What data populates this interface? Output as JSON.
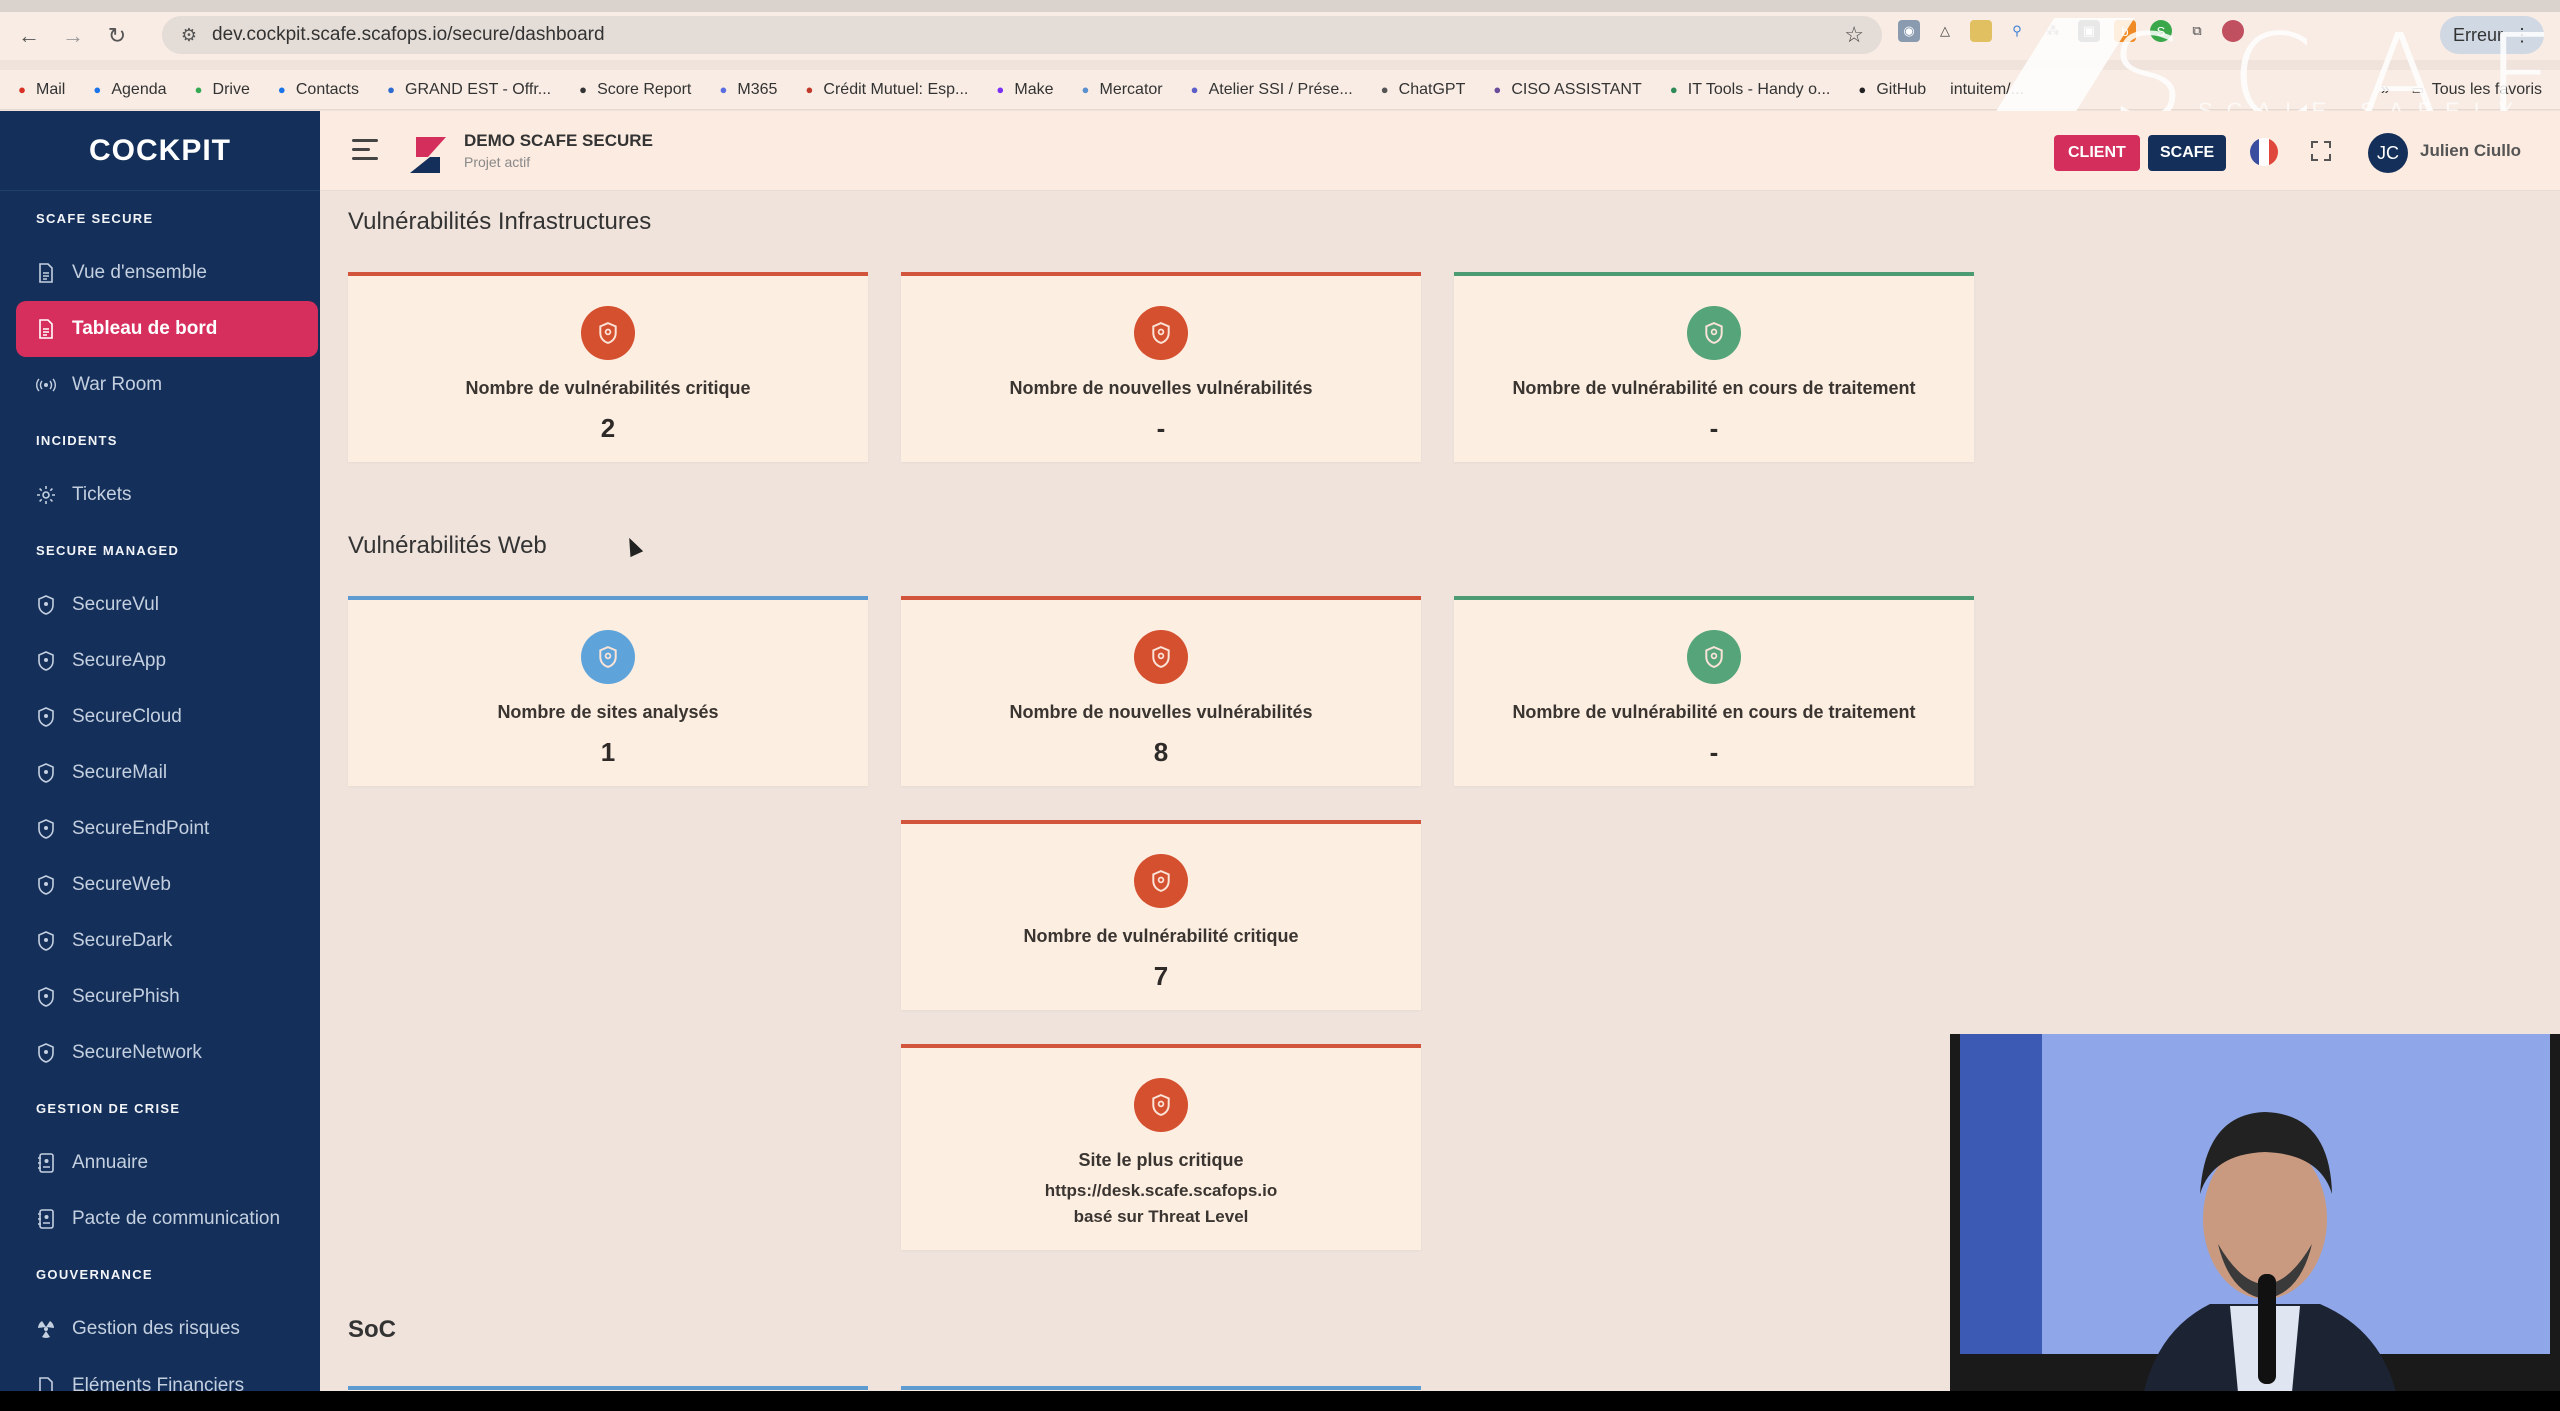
{
  "browser": {
    "url": "dev.cockpit.scafe.scafops.io/secure/dashboard",
    "profile_status": "Erreur",
    "bookmarks": [
      {
        "label": "Mail",
        "icon": "gmail-icon",
        "color": "#d93025"
      },
      {
        "label": "Agenda",
        "icon": "calendar-icon",
        "color": "#1a73e8"
      },
      {
        "label": "Drive",
        "icon": "drive-icon",
        "color": "#34a853"
      },
      {
        "label": "Contacts",
        "icon": "contacts-icon",
        "color": "#1a73e8"
      },
      {
        "label": "GRAND EST - Offr...",
        "icon": "check-icon",
        "color": "#2d6bd1"
      },
      {
        "label": "Score Report",
        "icon": "globe-icon",
        "color": "#333333"
      },
      {
        "label": "M365",
        "icon": "m365-icon",
        "color": "#5b6ee1"
      },
      {
        "label": "Crédit Mutuel: Esp...",
        "icon": "credit-mutuel-icon",
        "color": "#c0392b"
      },
      {
        "label": "Make",
        "icon": "make-icon",
        "color": "#7b2ff7"
      },
      {
        "label": "Mercator",
        "icon": "pin-icon",
        "color": "#5a8fd0"
      },
      {
        "label": "Atelier SSI / Prése...",
        "icon": "form-icon",
        "color": "#5b5fc7"
      },
      {
        "label": "ChatGPT",
        "icon": "chatgpt-icon",
        "color": "#555555"
      },
      {
        "label": "CISO ASSISTANT",
        "icon": "octopus-icon",
        "color": "#6a4c9c"
      },
      {
        "label": "IT Tools - Handy o...",
        "icon": "tools-icon",
        "color": "#2e8b57"
      },
      {
        "label": "GitHub",
        "icon": "github-icon",
        "color": "#222222"
      },
      {
        "label": "intuitem/...",
        "icon": "",
        "color": "#333333"
      }
    ],
    "more_bookmarks": "»",
    "all_bookmarks": "Tous les favoris"
  },
  "watermark": {
    "brand": "SCAFE",
    "tagline": "SCALE SAFELY"
  },
  "sidebar": {
    "logo": "COCKPIT",
    "sections": [
      {
        "title": "SCAFE SECURE",
        "items": [
          {
            "label": "Vue d'ensemble",
            "icon": "document-icon",
            "active": false
          },
          {
            "label": "Tableau de bord",
            "icon": "document-icon",
            "active": true
          },
          {
            "label": "War Room",
            "icon": "broadcast-icon",
            "active": false
          }
        ]
      },
      {
        "title": "INCIDENTS",
        "items": [
          {
            "label": "Tickets",
            "icon": "gear-icon",
            "active": false
          }
        ]
      },
      {
        "title": "SECURE MANAGED",
        "items": [
          {
            "label": "SecureVul",
            "icon": "shield-icon",
            "active": false
          },
          {
            "label": "SecureApp",
            "icon": "shield-icon",
            "active": false
          },
          {
            "label": "SecureCloud",
            "icon": "shield-icon",
            "active": false
          },
          {
            "label": "SecureMail",
            "icon": "shield-icon",
            "active": false
          },
          {
            "label": "SecureEndPoint",
            "icon": "shield-icon",
            "active": false
          },
          {
            "label": "SecureWeb",
            "icon": "shield-icon",
            "active": false
          },
          {
            "label": "SecureDark",
            "icon": "shield-icon",
            "active": false
          },
          {
            "label": "SecurePhish",
            "icon": "shield-icon",
            "active": false
          },
          {
            "label": "SecureNetwork",
            "icon": "shield-icon",
            "active": false
          }
        ]
      },
      {
        "title": "GESTION DE CRISE",
        "items": [
          {
            "label": "Annuaire",
            "icon": "address-book-icon",
            "active": false
          },
          {
            "label": "Pacte de communication",
            "icon": "address-book-icon",
            "active": false
          }
        ]
      },
      {
        "title": "GOUVERNANCE",
        "items": [
          {
            "label": "Gestion des risques",
            "icon": "hazard-icon",
            "active": false
          },
          {
            "label": "Eléments Financiers",
            "icon": "finance-doc-icon",
            "active": false
          }
        ]
      }
    ]
  },
  "header": {
    "project_name": "DEMO SCAFE SECURE",
    "project_status": "Projet actif",
    "client_button": "CLIENT",
    "scafe_button": "SCAFE",
    "language": "FR",
    "user_initials": "JC",
    "user_name": "Julien Ciullo"
  },
  "colors": {
    "critical": "#d4502f",
    "info": "#5ea4da",
    "success": "#55a47a",
    "sidebar_bg": "#14305a",
    "active_item": "#d62f5e"
  },
  "sections": {
    "infra": {
      "title": "Vulnérabilités Infrastructures",
      "cards": [
        {
          "label": "Nombre de vulnérabilités critique",
          "value": "2",
          "tone": "critical"
        },
        {
          "label": "Nombre de nouvelles vulnérabilités",
          "value": "-",
          "tone": "critical"
        },
        {
          "label": "Nombre de vulnérabilité en cours de traitement",
          "value": "-",
          "tone": "success"
        }
      ]
    },
    "web": {
      "title": "Vulnérabilités Web",
      "cards": [
        {
          "label": "Nombre de sites analysés",
          "value": "1",
          "tone": "info"
        },
        {
          "label": "Nombre de nouvelles vulnérabilités",
          "value": "8",
          "tone": "critical"
        },
        {
          "label": "Nombre de vulnérabilité en cours de traitement",
          "value": "-",
          "tone": "success"
        },
        {
          "label": "Nombre de vulnérabilité critique",
          "value": "7",
          "tone": "critical"
        },
        {
          "label": "Site le plus critique",
          "url": "https://desk.scafe.scafops.io",
          "basis": "basé sur Threat Level",
          "tone": "critical"
        }
      ]
    },
    "soc": {
      "title": "SoC"
    }
  }
}
